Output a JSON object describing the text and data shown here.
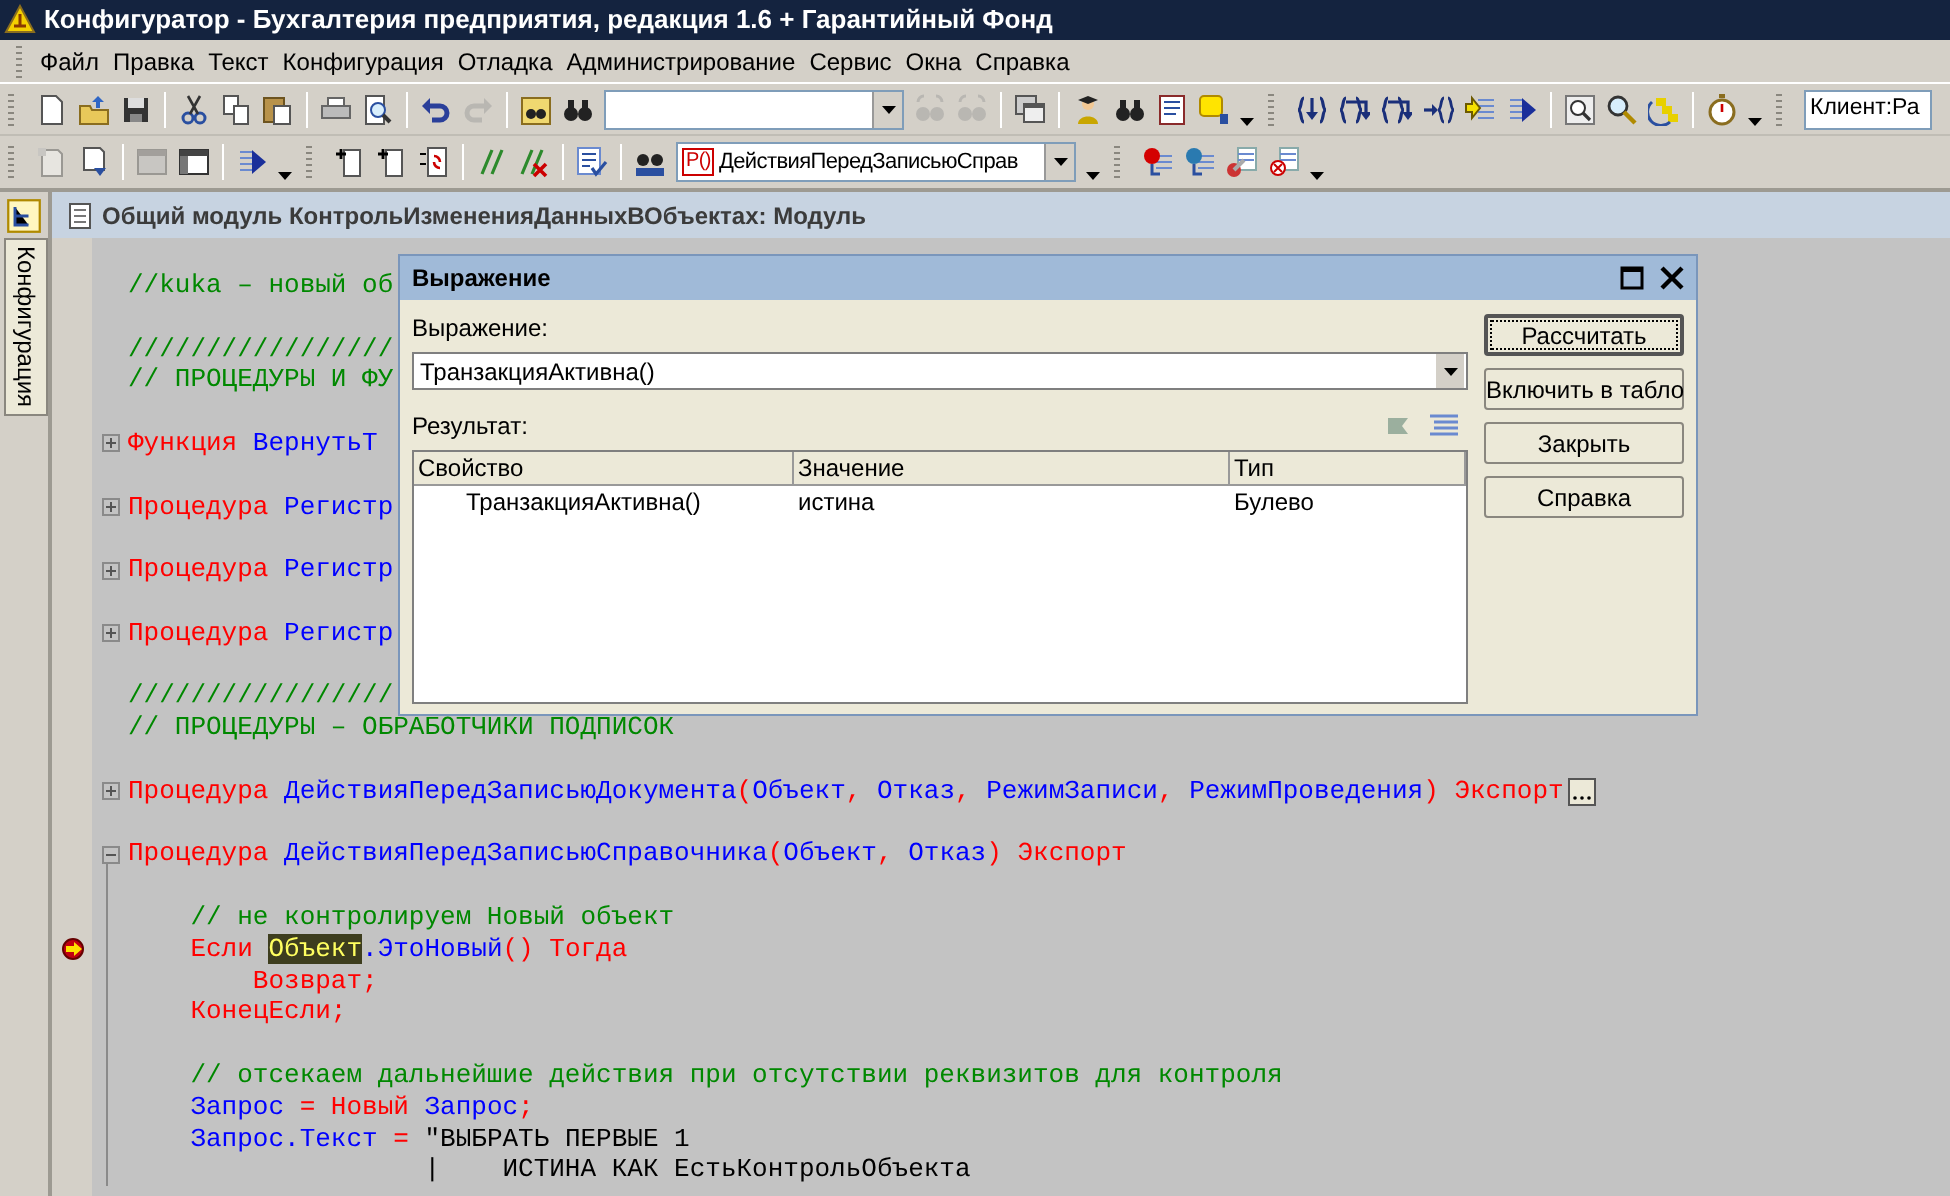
{
  "window": {
    "title": "Конфигуратор - Бухгалтерия предприятия, редакция 1.6 + Гарантийный Фонд"
  },
  "menu": [
    "Файл",
    "Правка",
    "Текст",
    "Конфигурация",
    "Отладка",
    "Администрирование",
    "Сервис",
    "Окна",
    "Справка"
  ],
  "toolbar": {
    "client_field": {
      "value": "Клиент:Ра"
    },
    "procedure_field": {
      "badge": "P()",
      "value": "ДействияПередЗаписьюСправ"
    }
  },
  "side_panel": {
    "tab": "Конфигурация"
  },
  "document": {
    "title": "Общий модуль КонтрольИзмененияДанныхВОбъектах: Модуль"
  },
  "code_lines": [
    {
      "kind": "code",
      "tokens": [
        {
          "text": "//kuka – новый об",
          "kind": "comment"
        }
      ]
    },
    {
      "kind": "blank"
    },
    {
      "kind": "code",
      "tokens": [
        {
          "text": "/////////////////",
          "kind": "comment"
        }
      ]
    },
    {
      "kind": "code",
      "tokens": [
        {
          "text": "// ПРОЦЕДУРЫ И ФУ",
          "kind": "comment"
        }
      ]
    },
    {
      "kind": "blank"
    },
    {
      "kind": "code",
      "fold": {
        "expanded": false
      },
      "tokens": [
        {
          "text": "Функция",
          "kind": "keyword"
        },
        {
          "text": " ВернутьТ",
          "kind": "ident"
        }
      ]
    },
    {
      "kind": "blank"
    },
    {
      "kind": "code",
      "fold": {
        "expanded": false
      },
      "tokens": [
        {
          "text": "Процедура",
          "kind": "keyword"
        },
        {
          "text": " Регистр",
          "kind": "ident"
        }
      ]
    },
    {
      "kind": "blank"
    },
    {
      "kind": "code",
      "fold": {
        "expanded": false
      },
      "tokens": [
        {
          "text": "Процедура",
          "kind": "keyword"
        },
        {
          "text": " Регистр",
          "kind": "ident"
        }
      ]
    },
    {
      "kind": "blank"
    },
    {
      "kind": "code",
      "fold": {
        "expanded": false
      },
      "tokens": [
        {
          "text": "Процедура",
          "kind": "keyword"
        },
        {
          "text": " Регистр",
          "kind": "ident"
        }
      ]
    },
    {
      "kind": "blank"
    },
    {
      "kind": "code",
      "tokens": [
        {
          "text": "/////////////////",
          "kind": "comment"
        }
      ]
    },
    {
      "kind": "code",
      "tokens": [
        {
          "text": "// ПРОЦЕДУРЫ – ОБРАБОТЧИКИ ПОДПИСОК",
          "kind": "comment"
        }
      ]
    },
    {
      "kind": "blank"
    },
    {
      "kind": "code",
      "fold": {
        "expanded": false
      },
      "tokens": [
        {
          "text": "Процедура",
          "kind": "keyword"
        },
        {
          "text": " ДействияПередЗаписьюДокумента",
          "kind": "ident"
        },
        {
          "text": "(",
          "kind": "operator"
        },
        {
          "text": "Объект",
          "kind": "ident"
        },
        {
          "text": ", ",
          "kind": "operator"
        },
        {
          "text": "Отказ",
          "kind": "ident"
        },
        {
          "text": ", ",
          "kind": "operator"
        },
        {
          "text": "РежимЗаписи",
          "kind": "ident"
        },
        {
          "text": ", ",
          "kind": "operator"
        },
        {
          "text": "РежимПроведения",
          "kind": "ident"
        },
        {
          "text": ") Экспорт",
          "kind": "keyword"
        }
      ]
    },
    {
      "kind": "blank"
    },
    {
      "kind": "code",
      "fold": {
        "expanded": true
      },
      "tokens": [
        {
          "text": "Процедура",
          "kind": "keyword"
        },
        {
          "text": " ДействияПередЗаписьюСправочника",
          "kind": "ident"
        },
        {
          "text": "(",
          "kind": "operator"
        },
        {
          "text": "Объект",
          "kind": "ident"
        },
        {
          "text": ", ",
          "kind": "operator"
        },
        {
          "text": "Отказ",
          "kind": "ident"
        },
        {
          "text": ") Экспорт",
          "kind": "keyword"
        }
      ]
    },
    {
      "kind": "blank"
    },
    {
      "kind": "code",
      "tokens": [
        {
          "text": "    // не контролируем Новый объект",
          "kind": "comment"
        }
      ]
    },
    {
      "kind": "code",
      "current_line": true,
      "tokens": [
        {
          "text": "    Если ",
          "kind": "keyword"
        },
        {
          "text": "Объект",
          "kind": "highlight"
        },
        {
          "text": ".ЭтоНовый",
          "kind": "ident"
        },
        {
          "text": "() Тогда",
          "kind": "keyword"
        }
      ]
    },
    {
      "kind": "code",
      "tokens": [
        {
          "text": "        Возврат;",
          "kind": "keyword"
        }
      ]
    },
    {
      "kind": "code",
      "tokens": [
        {
          "text": "    КонецЕсли;",
          "kind": "keyword"
        }
      ]
    },
    {
      "kind": "blank"
    },
    {
      "kind": "code",
      "tokens": [
        {
          "text": "    // отсекаем дальнейшие действия при отсутствии реквизитов для контроля",
          "kind": "comment"
        }
      ]
    },
    {
      "kind": "code",
      "tokens": [
        {
          "text": "    Запрос",
          "kind": "ident"
        },
        {
          "text": " = Новый ",
          "kind": "keyword"
        },
        {
          "text": "Запрос",
          "kind": "ident"
        },
        {
          "text": ";",
          "kind": "operator"
        }
      ]
    },
    {
      "kind": "code",
      "tokens": [
        {
          "text": "    Запрос.Текст",
          "kind": "ident"
        },
        {
          "text": " = ",
          "kind": "operator"
        },
        {
          "text": "\"ВЫБРАТЬ ПЕРВЫЕ 1",
          "kind": "string"
        }
      ]
    },
    {
      "kind": "code",
      "tokens": [
        {
          "text": "                   |    ИСТИНА КАК ЕстьКонтрольОбъекта",
          "kind": "string"
        }
      ]
    }
  ],
  "dialog": {
    "title": "Выражение",
    "expression_label": "Выражение:",
    "expression": "ТранзакцияАктивна()",
    "result_label": "Результат:",
    "columns": [
      "Свойство",
      "Значение",
      "Тип"
    ],
    "rows": [
      [
        "ТранзакцияАктивна()",
        "истина",
        "Булево"
      ]
    ],
    "buttons": [
      {
        "label": "Рассчитать",
        "default": true
      },
      {
        "label": "Включить в табло",
        "default": false
      },
      {
        "label": "Закрыть",
        "default": false
      },
      {
        "label": "Справка",
        "default": false
      }
    ]
  }
}
